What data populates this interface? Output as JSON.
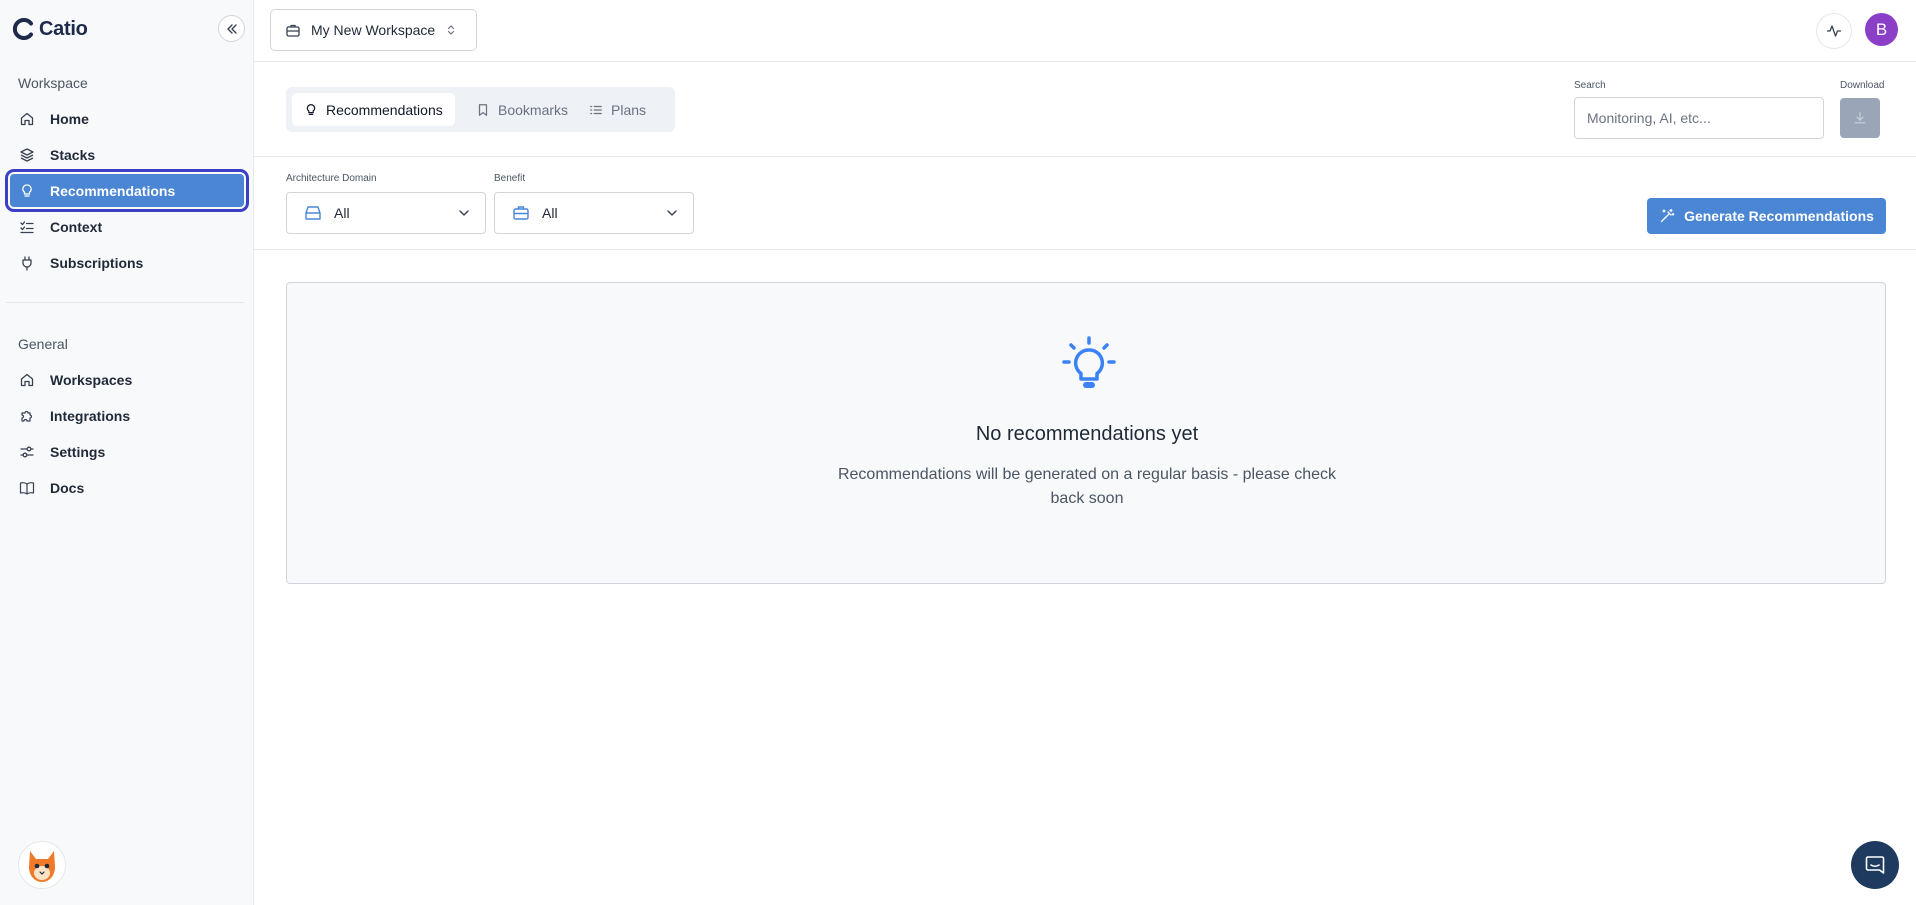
{
  "app": {
    "name": "Catio",
    "logo_icon": "catio-c-logo"
  },
  "sidebar": {
    "workspace_section": "Workspace",
    "workspace_items": [
      {
        "label": "Home",
        "icon": "home-icon"
      },
      {
        "label": "Stacks",
        "icon": "layers-icon"
      },
      {
        "label": "Recommendations",
        "icon": "lightbulb-icon",
        "active": true
      },
      {
        "label": "Context",
        "icon": "checklist-icon"
      },
      {
        "label": "Subscriptions",
        "icon": "plug-icon"
      }
    ],
    "general_section": "General",
    "general_items": [
      {
        "label": "Workspaces",
        "icon": "home-icon"
      },
      {
        "label": "Integrations",
        "icon": "puzzle-icon"
      },
      {
        "label": "Settings",
        "icon": "sliders-icon"
      },
      {
        "label": "Docs",
        "icon": "book-icon"
      }
    ]
  },
  "header": {
    "workspace_selector": "My New Workspace",
    "avatar_initial": "B"
  },
  "tabs": [
    {
      "label": "Recommendations",
      "icon": "lightbulb-icon",
      "active": true
    },
    {
      "label": "Bookmarks",
      "icon": "bookmark-icon"
    },
    {
      "label": "Plans",
      "icon": "list-icon"
    }
  ],
  "search": {
    "label": "Search",
    "placeholder": "Monitoring, AI, etc..."
  },
  "download": {
    "label": "Download"
  },
  "filters": {
    "architecture_domain": {
      "label": "Architecture Domain",
      "value": "All"
    },
    "benefit": {
      "label": "Benefit",
      "value": "All"
    }
  },
  "generate_button": "Generate Recommendations",
  "empty_state": {
    "title": "No recommendations yet",
    "description": "Recommendations will be generated on a regular basis - please check back soon"
  },
  "colors": {
    "accent": "#4a86d4",
    "active_outline": "#3b3fc4",
    "avatar": "#8b3fc7",
    "chat": "#1e3a5f"
  }
}
